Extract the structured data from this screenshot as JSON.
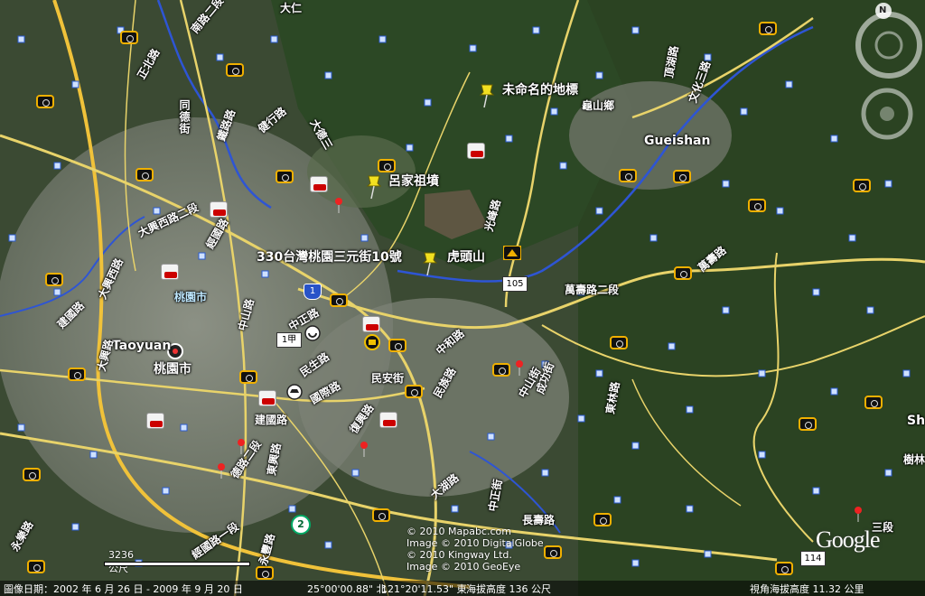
{
  "map": {
    "place_labels": {
      "unnamed": "未命名的地標",
      "guishan_township": "龜山鄉",
      "gueishan": "Gueishan",
      "lu_family_tomb": "呂家祖墳",
      "address": "330台灣桃園三元街10號",
      "hutoushan": "虎頭山",
      "taoyuan_city_1": "桃園市",
      "taoyuan_en": "Taoyuan",
      "taoyuan_city_2": "桃園市",
      "sh": "Sh",
      "shulin": "樹林"
    },
    "road_labels": [
      {
        "id": "r1",
        "text": "南路二段"
      },
      {
        "id": "r2",
        "text": "正北路"
      },
      {
        "id": "r3",
        "text": "大仁"
      },
      {
        "id": "r4",
        "text": "同德街"
      },
      {
        "id": "r5",
        "text": "鐵路路"
      },
      {
        "id": "r6",
        "text": "健行路"
      },
      {
        "id": "r7",
        "text": "大德三"
      },
      {
        "id": "r8",
        "text": "大興西路二段"
      },
      {
        "id": "r9",
        "text": "經國路"
      },
      {
        "id": "r10",
        "text": "建國路"
      },
      {
        "id": "r11",
        "text": "中山路"
      },
      {
        "id": "r12",
        "text": "中正路"
      },
      {
        "id": "r13",
        "text": "民生路"
      },
      {
        "id": "r14",
        "text": "國際路"
      },
      {
        "id": "r15",
        "text": "大興西路"
      },
      {
        "id": "r16",
        "text": "中和路"
      },
      {
        "id": "r17",
        "text": "建國路"
      },
      {
        "id": "r18",
        "text": "德路二段"
      },
      {
        "id": "r19",
        "text": "復興路"
      },
      {
        "id": "r20",
        "text": "民安街"
      },
      {
        "id": "r21",
        "text": "民族路"
      },
      {
        "id": "r22",
        "text": "東興路"
      },
      {
        "id": "r23",
        "text": "大湖路"
      },
      {
        "id": "r24",
        "text": "頂湖路"
      },
      {
        "id": "r25",
        "text": "萬壽路二段"
      },
      {
        "id": "r26",
        "text": "光峰路"
      },
      {
        "id": "r27",
        "text": "中山街"
      },
      {
        "id": "r28",
        "text": "中正街"
      },
      {
        "id": "r29",
        "text": "成功街"
      },
      {
        "id": "r30",
        "text": "萬壽路"
      },
      {
        "id": "r31",
        "text": "東林路"
      },
      {
        "id": "r32",
        "text": "長壽路"
      },
      {
        "id": "r33",
        "text": "永樂路"
      },
      {
        "id": "r34",
        "text": "大興路"
      },
      {
        "id": "r35",
        "text": "經國路一段"
      },
      {
        "id": "r36",
        "text": "永豐路"
      },
      {
        "id": "r37",
        "text": "文化三路"
      },
      {
        "id": "r38",
        "text": "三段"
      }
    ],
    "route_shields": [
      {
        "id": "s1",
        "text": "1",
        "kind": "national"
      },
      {
        "id": "s2",
        "text": "105",
        "kind": "county"
      },
      {
        "id": "s3",
        "text": "2",
        "kind": "provincial"
      },
      {
        "id": "s4",
        "text": "114",
        "kind": "county"
      },
      {
        "id": "s5",
        "text": "1甲",
        "kind": "county"
      }
    ]
  },
  "copyright": {
    "line1": "© 2010 Mapabc.com",
    "line2": "Image © 2010 DigitalGlobe",
    "line3": "© 2010 Kingway Ltd.",
    "line4": "Image © 2010 GeoEye"
  },
  "google_logo": "Google",
  "scale": {
    "label": "3236 公尺"
  },
  "status": {
    "imagery_date": "圖像日期：2002 年 6 月 26 日 - 2009 年 9 月 20 日",
    "lat": "25°00'00.88\" 北",
    "lon": "121°20'11.53\" 東",
    "elevation": "海拔高度  136 公尺",
    "eye_alt": "視角海拔高度  11.32 公里"
  },
  "compass": {
    "north": "N"
  },
  "colors": {
    "water": "#2e55d4",
    "road": "#e8d36a",
    "major_road": "#f0c23a",
    "forest": "#2d4a22",
    "urban": "#7d8276"
  }
}
